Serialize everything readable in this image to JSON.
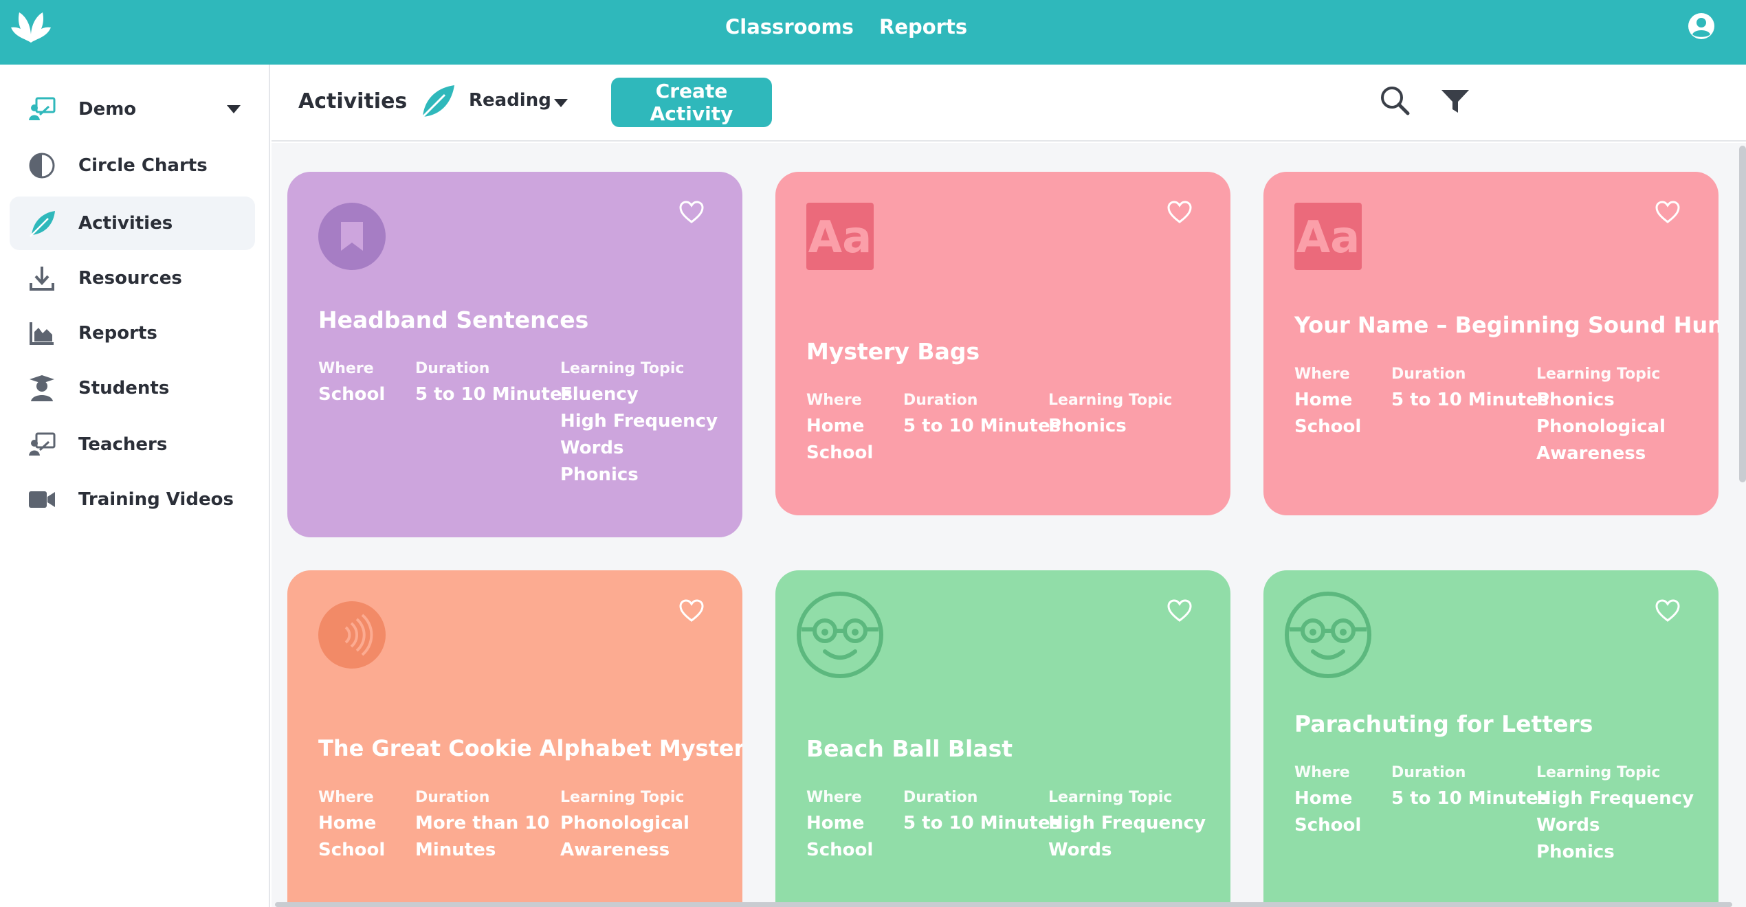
{
  "topbar": {
    "nav": [
      "Classrooms",
      "Reports"
    ]
  },
  "sidebar": {
    "header_label": "Demo",
    "items": [
      {
        "label": "Circle Charts",
        "icon": "half-circle-icon"
      },
      {
        "label": "Activities",
        "icon": "leaf-icon",
        "active": true
      },
      {
        "label": "Resources",
        "icon": "download-icon"
      },
      {
        "label": "Reports",
        "icon": "bar-chart-icon"
      },
      {
        "label": "Students",
        "icon": "student-icon"
      },
      {
        "label": "Teachers",
        "icon": "teacher-icon"
      },
      {
        "label": "Training Videos",
        "icon": "video-camera-icon"
      }
    ]
  },
  "header": {
    "title": "Activities",
    "category": "Reading",
    "create_label": "Create Activity"
  },
  "meta_labels": {
    "where": "Where",
    "duration": "Duration",
    "topic": "Learning Topic"
  },
  "cards": [
    {
      "title": "Headband Sentences",
      "color": "#cda5dd",
      "icon": "bookmark-icon",
      "where": [
        "School"
      ],
      "duration": [
        "5 to 10 Minutes"
      ],
      "topics": [
        "Fluency",
        "High Frequency",
        "Words",
        "Phonics"
      ]
    },
    {
      "title": "Mystery Bags",
      "color": "#fb9fa9",
      "icon": "font-aa-icon",
      "where": [
        "Home",
        "School"
      ],
      "duration": [
        "5 to 10 Minutes"
      ],
      "topics": [
        "Phonics"
      ]
    },
    {
      "title": "Your Name – Beginning Sound Hunt",
      "color": "#fb9fa9",
      "icon": "font-aa-icon",
      "where": [
        "Home",
        "School"
      ],
      "duration": [
        "5 to 10 Minutes"
      ],
      "topics": [
        "Phonics",
        "Phonological",
        "Awareness"
      ]
    },
    {
      "title": "The Great Cookie Alphabet Mystery",
      "color": "#fcab91",
      "icon": "sound-waves-icon",
      "where": [
        "Home",
        "School"
      ],
      "duration": [
        "More than 10",
        "Minutes"
      ],
      "topics": [
        "Phonological",
        "Awareness"
      ]
    },
    {
      "title": "Beach Ball Blast",
      "color": "#91dda8",
      "icon": "nerd-face-icon",
      "where": [
        "Home",
        "School"
      ],
      "duration": [
        "5 to 10 Minutes"
      ],
      "topics": [
        "High Frequency",
        "Words"
      ]
    },
    {
      "title": "Parachuting for Letters",
      "color": "#91dda8",
      "icon": "nerd-face-icon",
      "where": [
        "Home",
        "School"
      ],
      "duration": [
        "5 to 10 Minutes"
      ],
      "topics": [
        "High Frequency",
        "Words",
        "Phonics"
      ]
    }
  ]
}
